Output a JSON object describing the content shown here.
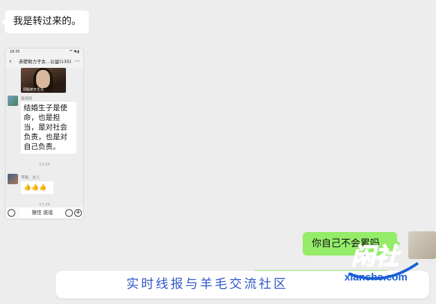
{
  "top_message": "我是转过来的。",
  "phone": {
    "status_time": "18:35",
    "status_right": "⁴ᴳ ◥ ▮",
    "chat_title": "赤壁助力子女...公益(135)",
    "video_caption": "洞姐老年生活",
    "sender1": "晨晓阳",
    "message1": "结婚生子是使命，也是担当，是对社会负责，也是对自己负责。",
    "time1": "13:33",
    "sender2": "萍聚、女儿",
    "message2": "👍👍👍",
    "time2": "17:29",
    "hold_to_talk": "按住 说话"
  },
  "self_message": "你自己不会累吗",
  "banner": {
    "text": "实时线报与羊毛交流社区",
    "logo_cn": "闲社",
    "logo_url": "xianshe.com"
  }
}
